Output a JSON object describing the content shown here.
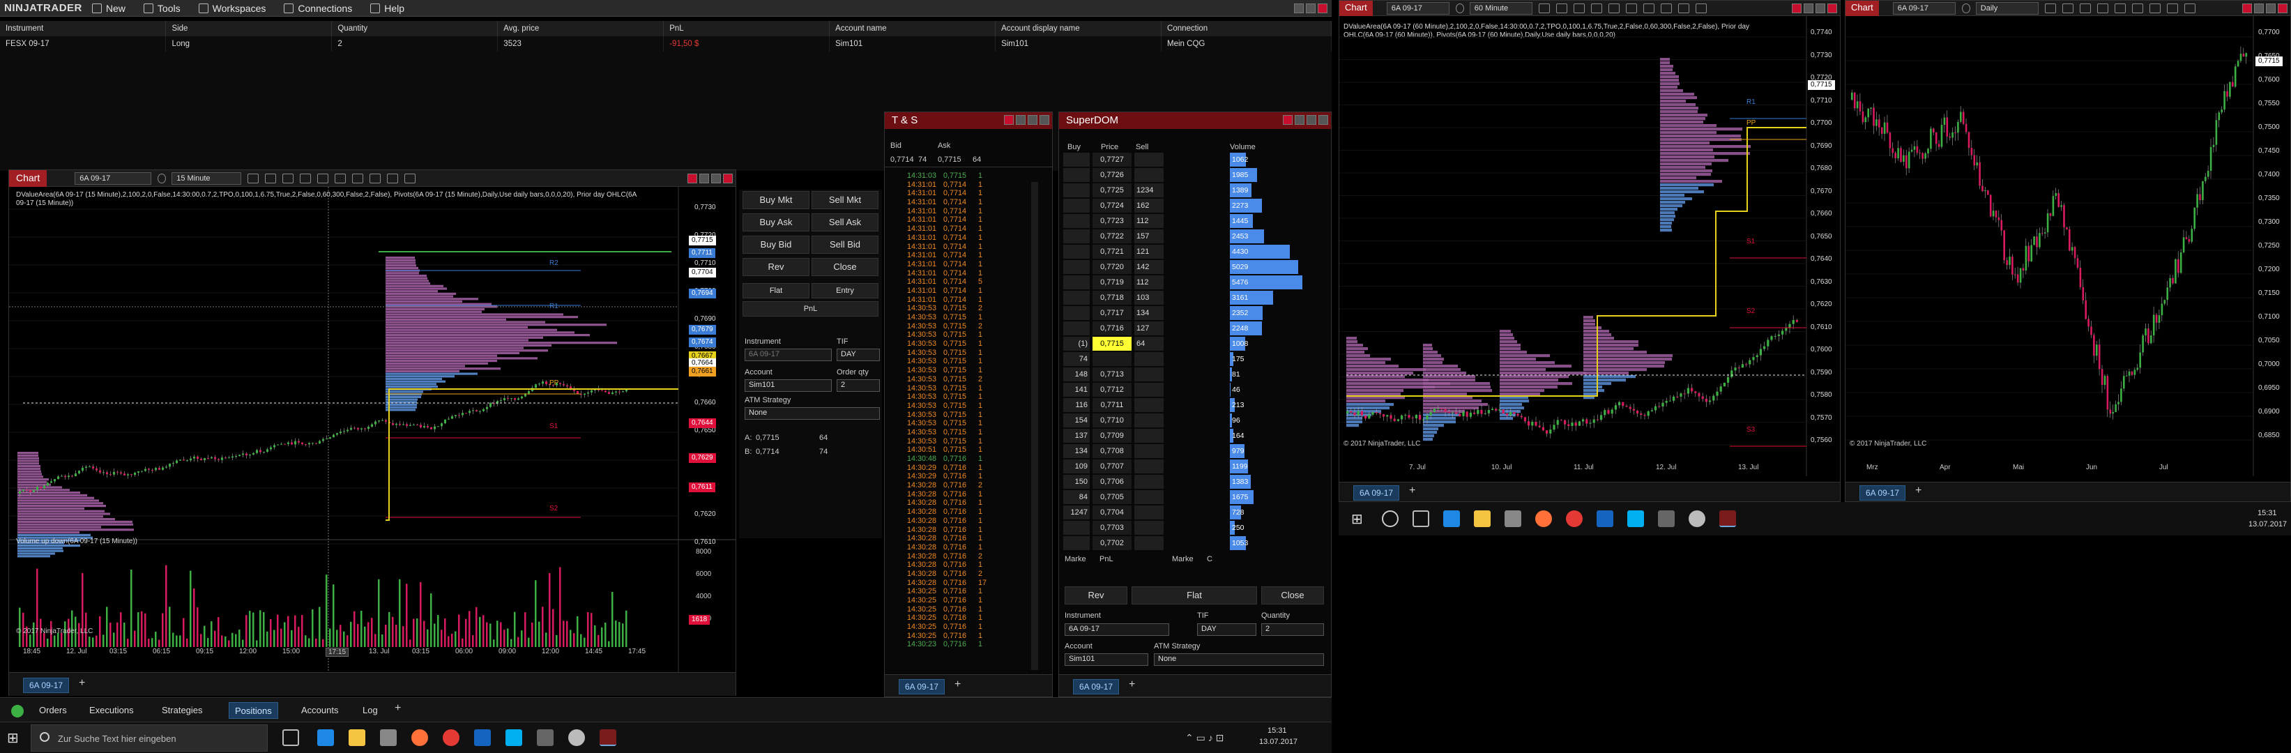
{
  "app": {
    "name": "NINJATRADER"
  },
  "menu": [
    "New",
    "Tools",
    "Workspaces",
    "Connections",
    "Help"
  ],
  "positions": {
    "headers": [
      "Instrument",
      "Side",
      "Quantity",
      "Avg. price",
      "PnL",
      "Account name",
      "Account display name",
      "Connection"
    ],
    "rows": [
      [
        "FESX 09-17",
        "Long",
        "2",
        "3523",
        "-91,50 $",
        "Sim101",
        "Sim101",
        "Mein CQG"
      ]
    ]
  },
  "chart1": {
    "title": "Chart",
    "instrument": "6A 09-17",
    "interval": "15 Minute",
    "info_line1": "DValueArea(6A 09-17 (15 Minute),2,100,2,0,False,14:30:00,0.7,2,TPO,0,100,1,6.75,True,2,False,0,60,300,False,2,False), Pivots(6A 09-17 (15 Minute),Daily,Use daily bars,0,0,0,20), Prior day OHLC(6A",
    "info_line2": "09-17 (15 Minute))",
    "volume_label": "Volume up down(6A 09-17 (15 Minute))",
    "copyright": "© 2017 NinjaTrader, LLC",
    "x_labels": [
      "18:45",
      "12. Jul",
      "03:15",
      "06:15",
      "09:15",
      "12:00",
      "15:00",
      "17:15",
      "13. Jul",
      "03:15",
      "06:00",
      "09:00",
      "12:00",
      "14:45",
      "17:45"
    ],
    "price_labels": [
      "0,7730",
      "0,7720",
      "0,7710",
      "0,7700",
      "0,7690",
      "0,7680",
      "0,7670",
      "0,7660",
      "0,7650",
      "0,7640",
      "0,7630",
      "0,7620",
      "0,7610"
    ],
    "tags": [
      {
        "v": "0,7715",
        "c": "#ffffff",
        "t": "#000000"
      },
      {
        "v": "0,7711",
        "c": "#3a7bd5",
        "t": "#ffffff"
      },
      {
        "v": "0,7704",
        "c": "#ffffff",
        "t": "#000000"
      },
      {
        "v": "0,7694",
        "c": "#3a7bd5",
        "t": "#ffffff"
      },
      {
        "v": "0,7679",
        "c": "#3a7bd5",
        "t": "#ffffff"
      },
      {
        "v": "0,7674",
        "c": "#3a7bd5",
        "t": "#ffffff"
      },
      {
        "v": "0,7667",
        "c": "#e6d21a",
        "t": "#000000"
      },
      {
        "v": "0,7664",
        "c": "#ffffff",
        "t": "#000000"
      },
      {
        "v": "0,7661",
        "c": "#f0a020",
        "t": "#000000"
      },
      {
        "v": "0,7644",
        "c": "#e0103a",
        "t": "#ffffff"
      },
      {
        "v": "0,7629",
        "c": "#e0103a",
        "t": "#ffffff"
      },
      {
        "v": "0,7611",
        "c": "#e0103a",
        "t": "#ffffff"
      }
    ],
    "vol_labels": [
      "8000",
      "6000",
      "4000",
      "2000"
    ],
    "vol_tag": "1618",
    "pivot_labels": [
      "R2",
      "R1",
      "PP",
      "S1",
      "S2"
    ],
    "tab": "6A 09-17"
  },
  "trader": {
    "buy_mkt": "Buy Mkt",
    "sell_mkt": "Sell Mkt",
    "buy_ask": "Buy Ask",
    "sell_ask": "Sell Ask",
    "buy_bid": "Buy Bid",
    "sell_bid": "Sell Bid",
    "rev": "Rev",
    "close": "Close",
    "flat": "Flat",
    "entry": "Entry",
    "pnl": "PnL",
    "instrument_label": "Instrument",
    "tif_label": "TIF",
    "instrument": "6A 09-17",
    "tif": "DAY",
    "account_label": "Account",
    "orderqty_label": "Order qty",
    "account": "Sim101",
    "qty": "2",
    "atm_label": "ATM Strategy",
    "atm": "None",
    "a_label": "A:",
    "a_price": "0,7715",
    "a_size": "64",
    "b_label": "B:",
    "b_price": "0,7714",
    "b_size": "74"
  },
  "tns": {
    "title": "T & S",
    "bid_label": "Bid",
    "ask_label": "Ask",
    "bid": "0,7714",
    "bid_sz": "74",
    "ask": "0,7715",
    "ask_sz": "64",
    "rows": [
      [
        "14:31:03",
        "0,7715",
        "1",
        "g"
      ],
      [
        "14:31:01",
        "0,7714",
        "1",
        "o"
      ],
      [
        "14:31:01",
        "0,7714",
        "1",
        "o"
      ],
      [
        "14:31:01",
        "0,7714",
        "1",
        "o"
      ],
      [
        "14:31:01",
        "0,7714",
        "1",
        "o"
      ],
      [
        "14:31:01",
        "0,7714",
        "1",
        "o"
      ],
      [
        "14:31:01",
        "0,7714",
        "1",
        "o"
      ],
      [
        "14:31:01",
        "0,7714",
        "1",
        "o"
      ],
      [
        "14:31:01",
        "0,7714",
        "1",
        "o"
      ],
      [
        "14:31:01",
        "0,7714",
        "1",
        "o"
      ],
      [
        "14:31:01",
        "0,7714",
        "1",
        "o"
      ],
      [
        "14:31:01",
        "0,7714",
        "1",
        "o"
      ],
      [
        "14:31:01",
        "0,7714",
        "5",
        "o"
      ],
      [
        "14:31:01",
        "0,7714",
        "1",
        "o"
      ],
      [
        "14:31:01",
        "0,7714",
        "1",
        "o"
      ],
      [
        "14:30:53",
        "0,7715",
        "2",
        "o"
      ],
      [
        "14:30:53",
        "0,7715",
        "1",
        "o"
      ],
      [
        "14:30:53",
        "0,7715",
        "2",
        "o"
      ],
      [
        "14:30:53",
        "0,7715",
        "1",
        "o"
      ],
      [
        "14:30:53",
        "0,7715",
        "1",
        "o"
      ],
      [
        "14:30:53",
        "0,7715",
        "1",
        "o"
      ],
      [
        "14:30:53",
        "0,7715",
        "1",
        "o"
      ],
      [
        "14:30:53",
        "0,7715",
        "1",
        "o"
      ],
      [
        "14:30:53",
        "0,7715",
        "2",
        "o"
      ],
      [
        "14:30:53",
        "0,7715",
        "1",
        "o"
      ],
      [
        "14:30:53",
        "0,7715",
        "1",
        "o"
      ],
      [
        "14:30:53",
        "0,7715",
        "1",
        "o"
      ],
      [
        "14:30:53",
        "0,7715",
        "1",
        "o"
      ],
      [
        "14:30:53",
        "0,7715",
        "1",
        "o"
      ],
      [
        "14:30:53",
        "0,7715",
        "1",
        "o"
      ],
      [
        "14:30:53",
        "0,7715",
        "1",
        "o"
      ],
      [
        "14:30:51",
        "0,7715",
        "1",
        "o"
      ],
      [
        "14:30:48",
        "0,7716",
        "1",
        "g"
      ],
      [
        "14:30:29",
        "0,7716",
        "1",
        "o"
      ],
      [
        "14:30:29",
        "0,7716",
        "1",
        "o"
      ],
      [
        "14:30:28",
        "0,7716",
        "2",
        "o"
      ],
      [
        "14:30:28",
        "0,7716",
        "1",
        "o"
      ],
      [
        "14:30:28",
        "0,7716",
        "1",
        "o"
      ],
      [
        "14:30:28",
        "0,7716",
        "1",
        "o"
      ],
      [
        "14:30:28",
        "0,7716",
        "1",
        "o"
      ],
      [
        "14:30:28",
        "0,7716",
        "1",
        "o"
      ],
      [
        "14:30:28",
        "0,7716",
        "1",
        "o"
      ],
      [
        "14:30:28",
        "0,7716",
        "1",
        "o"
      ],
      [
        "14:30:28",
        "0,7716",
        "2",
        "o"
      ],
      [
        "14:30:28",
        "0,7716",
        "1",
        "o"
      ],
      [
        "14:30:28",
        "0,7716",
        "2",
        "o"
      ],
      [
        "14:30:28",
        "0,7716",
        "17",
        "o"
      ],
      [
        "14:30:25",
        "0,7716",
        "1",
        "o"
      ],
      [
        "14:30:25",
        "0,7716",
        "1",
        "o"
      ],
      [
        "14:30:25",
        "0,7716",
        "1",
        "o"
      ],
      [
        "14:30:25",
        "0,7716",
        "1",
        "o"
      ],
      [
        "14:30:25",
        "0,7716",
        "1",
        "o"
      ],
      [
        "14:30:25",
        "0,7716",
        "1",
        "o"
      ],
      [
        "14:30:23",
        "0,7716",
        "1",
        "g"
      ]
    ],
    "tab": "6A 09-17"
  },
  "dom": {
    "title": "SuperDOM",
    "headers": {
      "buy": "Buy",
      "price": "Price",
      "sell": "Sell",
      "volume": "Volume"
    },
    "rows": [
      {
        "buy": "",
        "price": "0,7727",
        "sell": "",
        "vol": "1062",
        "w": 0.18
      },
      {
        "buy": "",
        "price": "0,7726",
        "sell": "",
        "vol": "1985",
        "w": 0.3
      },
      {
        "buy": "",
        "price": "0,7725",
        "sell": "1234",
        "vol": "1389",
        "w": 0.24
      },
      {
        "buy": "",
        "price": "0,7724",
        "sell": "162",
        "vol": "2273",
        "w": 0.35
      },
      {
        "buy": "",
        "price": "0,7723",
        "sell": "112",
        "vol": "1445",
        "w": 0.25
      },
      {
        "buy": "",
        "price": "0,7722",
        "sell": "157",
        "vol": "2453",
        "w": 0.38
      },
      {
        "buy": "",
        "price": "0,7721",
        "sell": "121",
        "vol": "4430",
        "w": 0.66
      },
      {
        "buy": "",
        "price": "0,7720",
        "sell": "142",
        "vol": "5029",
        "w": 0.75
      },
      {
        "buy": "",
        "price": "0,7719",
        "sell": "112",
        "vol": "5476",
        "w": 0.8
      },
      {
        "buy": "",
        "price": "0,7718",
        "sell": "103",
        "vol": "3161",
        "w": 0.48
      },
      {
        "buy": "",
        "price": "0,7717",
        "sell": "134",
        "vol": "2352",
        "w": 0.36
      },
      {
        "buy": "",
        "price": "0,7716",
        "sell": "127",
        "vol": "2248",
        "w": 0.35
      },
      {
        "buy": "(1)",
        "price": "0,7715",
        "sell": "64",
        "vol": "1008",
        "w": 0.17,
        "hl": true
      },
      {
        "buy": "74",
        "price": "",
        "sell": "",
        "vol": "175",
        "w": 0.04
      },
      {
        "buy": "148",
        "price": "0,7713",
        "sell": "",
        "vol": "81",
        "w": 0.02
      },
      {
        "buy": "141",
        "price": "0,7712",
        "sell": "",
        "vol": "46",
        "w": 0.01
      },
      {
        "buy": "116",
        "price": "0,7711",
        "sell": "",
        "vol": "213",
        "w": 0.05
      },
      {
        "buy": "154",
        "price": "0,7710",
        "sell": "",
        "vol": "96",
        "w": 0.02
      },
      {
        "buy": "137",
        "price": "0,7709",
        "sell": "",
        "vol": "164",
        "w": 0.04
      },
      {
        "buy": "134",
        "price": "0,7708",
        "sell": "",
        "vol": "979",
        "w": 0.16
      },
      {
        "buy": "109",
        "price": "0,7707",
        "sell": "",
        "vol": "1199",
        "w": 0.2
      },
      {
        "buy": "150",
        "price": "0,7706",
        "sell": "",
        "vol": "1383",
        "w": 0.23
      },
      {
        "buy": "84",
        "price": "0,7705",
        "sell": "",
        "vol": "1675",
        "w": 0.26
      },
      {
        "buy": "1247",
        "price": "0,7704",
        "sell": "",
        "vol": "728",
        "w": 0.12
      },
      {
        "buy": "",
        "price": "0,7703",
        "sell": "",
        "vol": "250",
        "w": 0.05
      },
      {
        "buy": "",
        "price": "0,7702",
        "sell": "",
        "vol": "1053",
        "w": 0.18
      }
    ],
    "market_l": "Marke",
    "pnl": "PnL",
    "market_r": "Marke",
    "c": "C",
    "rev": "Rev",
    "flat": "Flat",
    "close": "Close",
    "instrument_label": "Instrument",
    "tif_label": "TIF",
    "qty_label": "Quantity",
    "instrument": "6A 09-17",
    "tif": "DAY",
    "qty": "2",
    "account_label": "Account",
    "atm_label": "ATM Strategy",
    "account": "Sim101",
    "atm": "None",
    "tab": "6A 09-17"
  },
  "chart2": {
    "title": "Chart",
    "instrument": "6A 09-17",
    "interval": "60 Minute",
    "info_line1": "DValueArea(6A 09-17 (60 Minute),2,100,2,0,False,14:30:00,0.7,2,TPO,0,100,1,6.75,True,2,False,0,60,300,False,2,False), Prior day",
    "info_line2": "OHLC(6A 09-17 (60 Minute)), Pivots(6A 09-17 (60 Minute),Daily,Use daily bars,0,0,0,20)",
    "price_labels": [
      "0,7740",
      "0,7730",
      "0,7720",
      "0,7710",
      "0,7700",
      "0,7690",
      "0,7680",
      "0,7670",
      "0,7660",
      "0,7650",
      "0,7640",
      "0,7630",
      "0,7620",
      "0,7610",
      "0,7600",
      "0,7590",
      "0,7580",
      "0,7570",
      "0,7560"
    ],
    "x_labels": [
      "7. Jul",
      "10. Jul",
      "11. Jul",
      "12. Jul",
      "13. Jul"
    ],
    "tag": "0,7715",
    "pivot_labels": [
      "R1",
      "PP",
      "S1",
      "S2",
      "S3"
    ],
    "copyright": "© 2017 NinjaTrader, LLC",
    "tab": "6A 09-17"
  },
  "chart3": {
    "title": "Chart",
    "instrument": "6A 09-17",
    "interval": "Daily",
    "price_labels": [
      "0,7700",
      "0,7650",
      "0,7600",
      "0,7550",
      "0,7500",
      "0,7450",
      "0,7400",
      "0,7350",
      "0,7300",
      "0,7250",
      "0,7200",
      "0,7150",
      "0,7100",
      "0,7050",
      "0,7000",
      "0,6950",
      "0,6900",
      "0,6850"
    ],
    "x_labels": [
      "Mrz",
      "Apr",
      "Mai",
      "Jun",
      "Jul"
    ],
    "tag": "0,7715",
    "copyright": "© 2017 NinjaTrader, LLC",
    "tab": "6A 09-17"
  },
  "control_tabs": [
    "Orders",
    "Executions",
    "Strategies",
    "Positions",
    "Accounts",
    "Log"
  ],
  "active_control_tab": "Positions",
  "taskbar1": {
    "search": "Zur Suche Text hier eingeben",
    "time": "15:31",
    "date": "13.07.2017"
  },
  "taskbar2": {
    "time": "15:31",
    "date": "13.07.2017"
  }
}
